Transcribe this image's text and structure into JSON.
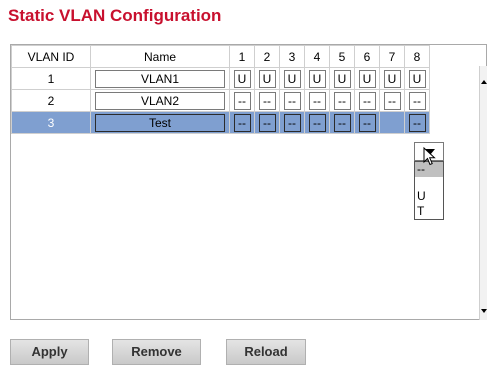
{
  "page": {
    "title": "Static VLAN Configuration"
  },
  "table": {
    "headers": [
      "VLAN ID",
      "Name",
      "1",
      "2",
      "3",
      "4",
      "5",
      "6",
      "7",
      "8"
    ],
    "rows": [
      {
        "id": "1",
        "name": "VLAN1",
        "ports": [
          "U",
          "U",
          "U",
          "U",
          "U",
          "U",
          "U",
          "U"
        ],
        "selected": false
      },
      {
        "id": "2",
        "name": "VLAN2",
        "ports": [
          "--",
          "--",
          "--",
          "--",
          "--",
          "--",
          "--",
          "--"
        ],
        "selected": false
      },
      {
        "id": "3",
        "name": "Test",
        "ports": [
          "--",
          "--",
          "--",
          "--",
          "--",
          "--",
          "",
          "--"
        ],
        "selected": true
      }
    ]
  },
  "port_dropdown": {
    "port": "7",
    "options": [
      "--",
      "U",
      "T"
    ],
    "highlighted": "--"
  },
  "buttons": {
    "apply": "Apply",
    "remove": "Remove",
    "reload": "Reload"
  },
  "colors": {
    "title": "#c8102e",
    "selected_row": "#7f9fd0"
  },
  "icons": [
    "dropdown-arrow-icon",
    "mouse-cursor-icon",
    "scroll-up-icon",
    "scroll-down-icon"
  ]
}
